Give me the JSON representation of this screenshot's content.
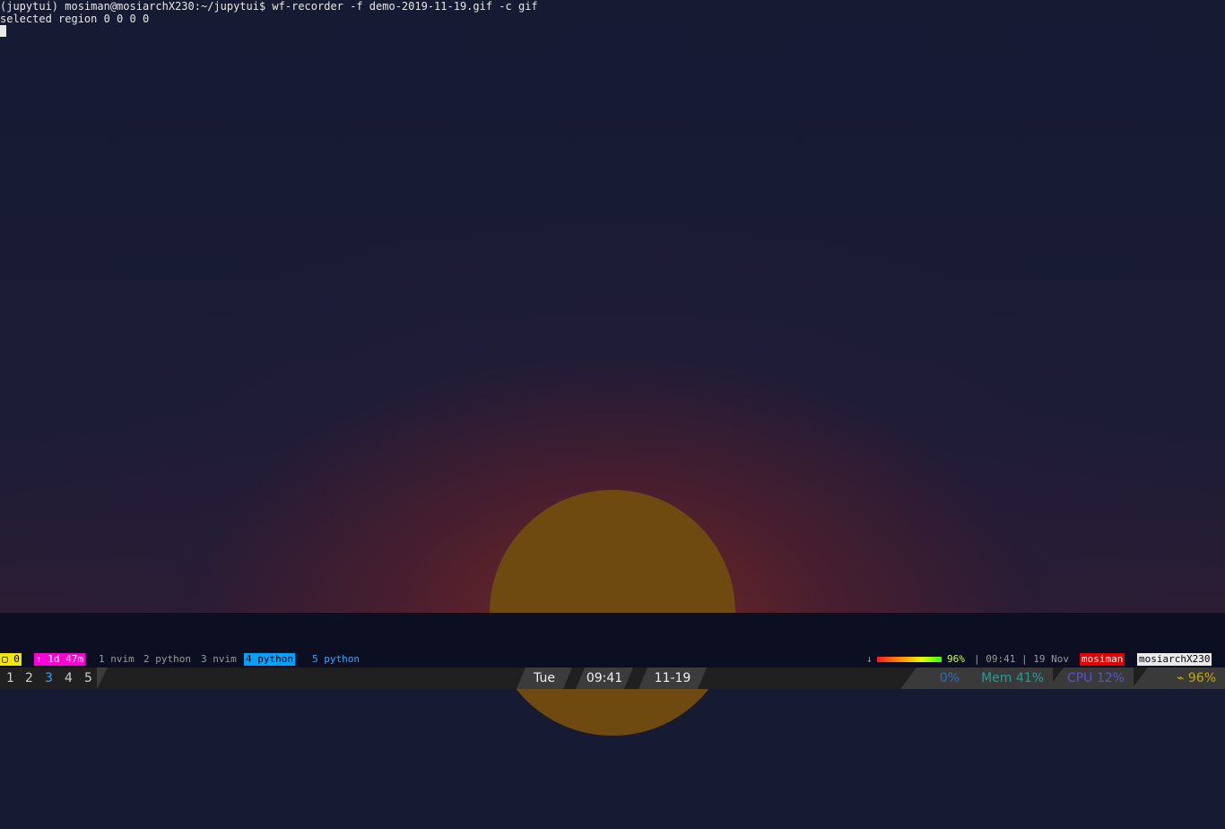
{
  "terminal": {
    "line1": "(jupytui) mosiman@mosiarchX230:~/jupytui$ wf-recorder -f demo-2019-11-19.gif -c gif",
    "line2": "selected region 0 0 0 0"
  },
  "tmux": {
    "session": "▢ 0",
    "uptime": "↑ 1d 47m",
    "windows": [
      {
        "label": "1 nvim",
        "active": false
      },
      {
        "label": "2 python",
        "active": false
      },
      {
        "label": "3 nvim",
        "active": false
      },
      {
        "label": "4 python",
        "active": true
      },
      {
        "label": "5 python",
        "active": false
      }
    ],
    "battery_arrow": "↓",
    "battery_percent": "96%",
    "battery_level": 0.96,
    "time": "| 09:41 | 19 Nov",
    "user": "mosiman",
    "host": "mosiarchX230"
  },
  "waybar": {
    "workspaces": [
      "1",
      "2",
      "3",
      "4",
      "5"
    ],
    "active_workspace": "3",
    "day": "Tue",
    "time": "09:41",
    "date": "11-19",
    "disk": "0%",
    "memory": "Mem 41%",
    "cpu": "CPU 12%",
    "battery": "⌁ 96%"
  },
  "colors": {
    "sky": "#161a33",
    "sun": "#6e4a10",
    "tmux_session": "#f3e600",
    "tmux_uptime": "#ff00d4",
    "tmux_active": "#00a2ff",
    "tmux_user": "#e00000",
    "workspace_active": "#3d9cff"
  }
}
